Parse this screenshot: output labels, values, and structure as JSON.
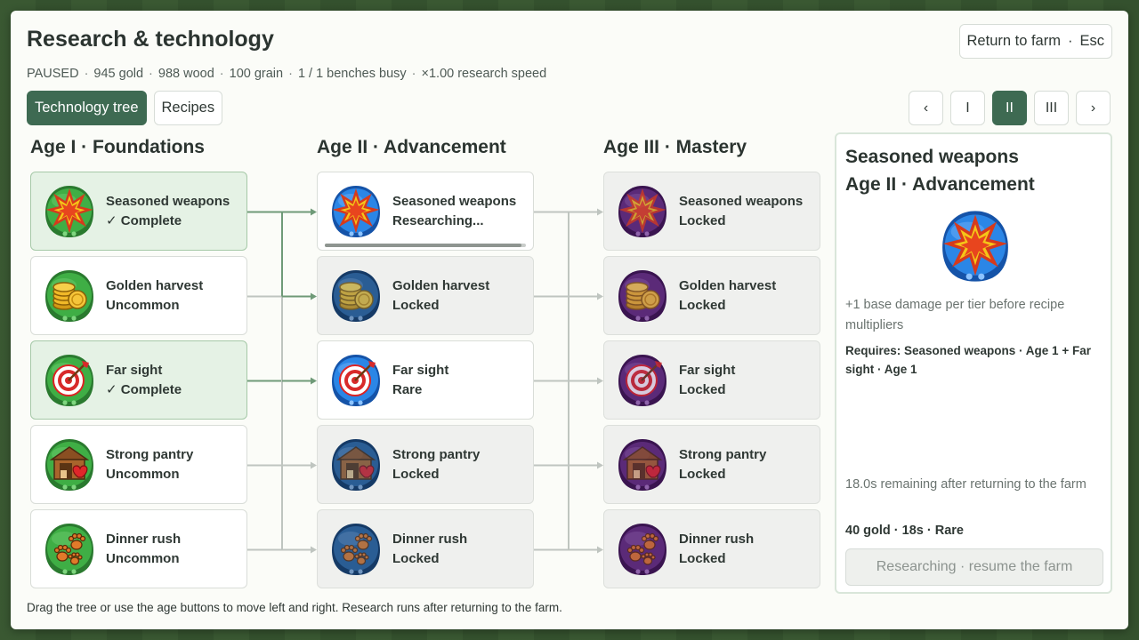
{
  "header": {
    "title": "Research & technology",
    "return_label": "Return to farm",
    "return_key": "Esc"
  },
  "stats": [
    "PAUSED",
    "945 gold",
    "988 wood",
    "100 grain",
    "1 / 1 benches busy",
    "×1.00 research speed"
  ],
  "tabs": [
    {
      "label": "Technology tree",
      "active": true
    },
    {
      "label": "Recipes",
      "active": false
    }
  ],
  "age_nav": {
    "prev": "‹",
    "next": "›",
    "ages": [
      "I",
      "II",
      "III"
    ],
    "active": "II"
  },
  "columns": [
    {
      "title": "Age I · Foundations",
      "theme": "green",
      "cards": [
        {
          "name": "Seasoned weapons",
          "status": "✓ Complete",
          "state": "complete",
          "icon": "explosion-icon"
        },
        {
          "name": "Golden harvest",
          "status": "Uncommon",
          "state": "available",
          "icon": "gold-coins-icon"
        },
        {
          "name": "Far sight",
          "status": "✓ Complete",
          "state": "complete",
          "icon": "target-icon"
        },
        {
          "name": "Strong pantry",
          "status": "Uncommon",
          "state": "available",
          "icon": "pantry-icon"
        },
        {
          "name": "Dinner rush",
          "status": "Uncommon",
          "state": "available",
          "icon": "paw-prints-icon"
        }
      ]
    },
    {
      "title": "Age II · Advancement",
      "theme": "blue",
      "cards": [
        {
          "name": "Seasoned weapons",
          "status": "Researching...",
          "state": "researching",
          "icon": "explosion-icon",
          "progress": 0.98
        },
        {
          "name": "Golden harvest",
          "status": "Locked",
          "state": "locked",
          "icon": "gold-coins-icon"
        },
        {
          "name": "Far sight",
          "status": "Rare",
          "state": "available",
          "icon": "target-icon"
        },
        {
          "name": "Strong pantry",
          "status": "Locked",
          "state": "locked",
          "icon": "pantry-icon"
        },
        {
          "name": "Dinner rush",
          "status": "Locked",
          "state": "locked",
          "icon": "paw-prints-icon"
        }
      ]
    },
    {
      "title": "Age III · Mastery",
      "theme": "purple",
      "cards": [
        {
          "name": "Seasoned weapons",
          "status": "Locked",
          "state": "locked",
          "icon": "explosion-icon"
        },
        {
          "name": "Golden harvest",
          "status": "Locked",
          "state": "locked",
          "icon": "gold-coins-icon"
        },
        {
          "name": "Far sight",
          "status": "Locked",
          "state": "locked",
          "icon": "target-icon"
        },
        {
          "name": "Strong pantry",
          "status": "Locked",
          "state": "locked",
          "icon": "pantry-icon"
        },
        {
          "name": "Dinner rush",
          "status": "Locked",
          "state": "locked",
          "icon": "paw-prints-icon"
        }
      ]
    }
  ],
  "detail": {
    "title": "Seasoned weapons",
    "subtitle": "Age II · Advancement",
    "icon": "explosion-icon",
    "description": "+1 base damage per tier before recipe multipliers",
    "requires": "Requires: Seasoned weapons · Age 1 + Far sight · Age 1",
    "remaining": "18.0s remaining after returning to the farm",
    "cost": "40 gold · 18s · Rare",
    "action": "Researching · resume the farm"
  },
  "hint": "Drag the tree or use the age buttons to move left and right. Research runs after returning to the farm.",
  "colors": {
    "accent": "#3e6a52",
    "green": "#2f9a3a",
    "blue": "#1f6fd1",
    "purple": "#6a2f8a"
  }
}
